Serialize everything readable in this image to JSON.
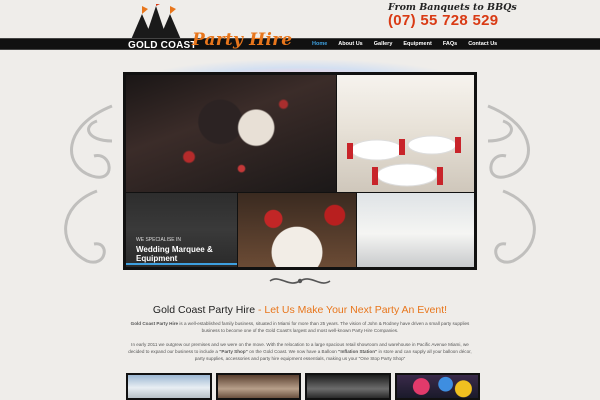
{
  "header": {
    "logo_line1": "GOLD COAST",
    "logo_line2": "Party Hire",
    "tagline": "From Banquets to BBQs",
    "phone": "(07) 55 728 529"
  },
  "nav": {
    "items": [
      {
        "label": "Home",
        "active": true
      },
      {
        "label": "About Us",
        "active": false
      },
      {
        "label": "Gallery",
        "active": false
      },
      {
        "label": "Equipment",
        "active": false
      },
      {
        "label": "FAQs",
        "active": false
      },
      {
        "label": "Contact Us",
        "active": false
      }
    ],
    "active_color": "#3ea0e0"
  },
  "hero": {
    "special_small": "WE SPECIALISE IN",
    "special_big": "Wedding Marquee & Equipment"
  },
  "content": {
    "headline_main": "Gold Coast Party Hire",
    "headline_accent": "- Let Us Make Your Next Party An Event!",
    "paragraph1_bold": "Gold Coast Party Hire",
    "paragraph1_rest": " is a well-established family business, situated in Miami for more than 25 years. The vision of John & Rodney have driven a small party supplies business to become one of the Gold Coast's largest and most well-known Party Hire Companies.",
    "paragraph2_a": "In early 2011 we outgrew our premises and we were on the move. With the relocation to a large spacious retail showroom and warehouse in Pacific Avenue Miami, we decided to expand our business to include a ",
    "paragraph2_b": "\"Party Shop\"",
    "paragraph2_c": " on the Gold Coast. We now have a Balloon ",
    "paragraph2_d": "\"Inflation Station\"",
    "paragraph2_e": " in store and can supply all your balloon décor, party supplies, accessories and party hire equipment essentials, making us your \"One Stop Party Shop\""
  },
  "colors": {
    "accent_orange": "#e8761c",
    "phone_red": "#d93a14",
    "nav_bar": "#111111",
    "background": "#efedea"
  }
}
